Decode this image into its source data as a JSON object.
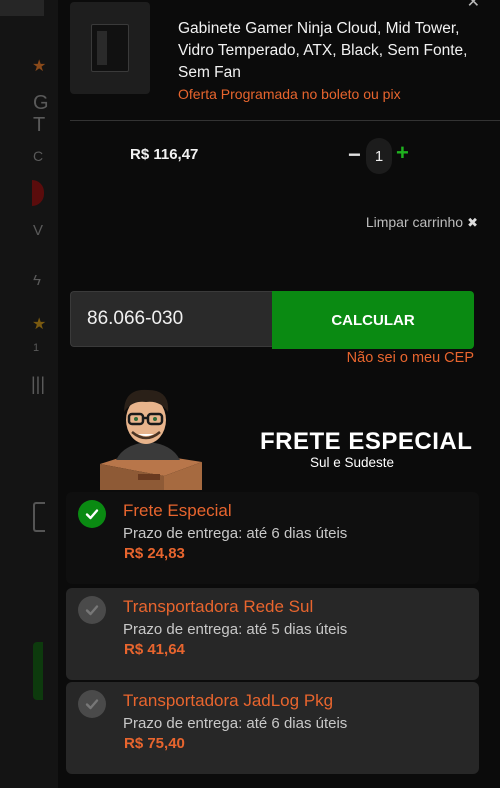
{
  "product": {
    "name": "Gabinete Gamer Ninja Cloud, Mid Tower, Vidro Temperado, ATX, Black, Sem Fonte, Sem Fan",
    "offer": "Oferta Programada no boleto ou pix",
    "price": "R$ 116,47",
    "quantity": "1",
    "image_icon": "pc-case-icon"
  },
  "cart": {
    "clear_label": "Limpar carrinho",
    "clear_icon": "✖"
  },
  "shipping": {
    "cep_value": "86.066-030",
    "calculate_label": "CALCULAR",
    "unknown_cep_link": "Não sei o meu CEP"
  },
  "banner": {
    "title": "FRETE ESPECIAL",
    "subtitle": "Sul e Sudeste"
  },
  "options": [
    {
      "name": "Frete Especial",
      "time": "Prazo de entrega: até 6 dias úteis",
      "price": "R$ 24,83",
      "selected": true
    },
    {
      "name": "Transportadora Rede Sul",
      "time": "Prazo de entrega: até 5 dias úteis",
      "price": "R$ 41,64",
      "selected": false
    },
    {
      "name": "Transportadora JadLog Pkg",
      "time": "Prazo de entrega: até 6 dias úteis",
      "price": "R$ 75,40",
      "selected": false
    }
  ],
  "colors": {
    "accent_orange": "#e8652e",
    "accent_green": "#0a8a12",
    "background": "#0b0b0b"
  }
}
